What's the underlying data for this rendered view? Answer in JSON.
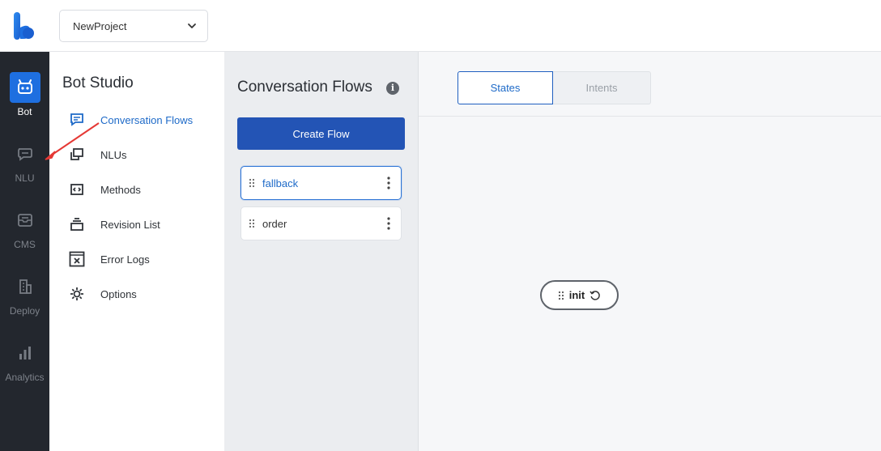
{
  "header": {
    "project": "NewProject"
  },
  "rail": {
    "items": [
      {
        "label": "Bot",
        "icon": "bot-icon",
        "active": true
      },
      {
        "label": "NLU",
        "icon": "chat-bubbles-icon"
      },
      {
        "label": "CMS",
        "icon": "inbox-icon"
      },
      {
        "label": "Deploy",
        "icon": "building-icon"
      },
      {
        "label": "Analytics",
        "icon": "bar-chart-icon"
      }
    ]
  },
  "studio": {
    "title": "Bot Studio",
    "menu": [
      {
        "label": "Conversation Flows",
        "icon": "chat-square-icon",
        "active": true
      },
      {
        "label": "NLUs",
        "icon": "stacked-squares-icon"
      },
      {
        "label": "Methods",
        "icon": "code-brackets-icon"
      },
      {
        "label": "Revision List",
        "icon": "stack-icon"
      },
      {
        "label": "Error Logs",
        "icon": "error-log-icon"
      },
      {
        "label": "Options",
        "icon": "gear-icon"
      }
    ]
  },
  "flows": {
    "title": "Conversation Flows",
    "info": "i",
    "create_label": "Create Flow",
    "items": [
      {
        "name": "fallback",
        "selected": true
      },
      {
        "name": "order"
      }
    ]
  },
  "canvas": {
    "tabs": {
      "states": "States",
      "intents": "Intents"
    },
    "state_node": "init"
  },
  "colors": {
    "rail_bg": "#23272e",
    "accent": "#1e6fe0",
    "primary_button": "#2354b5",
    "annotation_arrow": "#e53935"
  }
}
